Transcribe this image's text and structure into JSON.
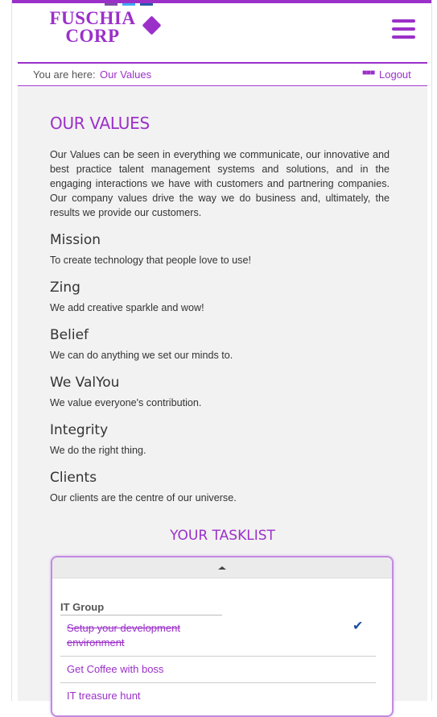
{
  "brand": {
    "line1": "FUSCHIA",
    "line2": "CORP",
    "color": "#9b30c9",
    "social_colors": [
      "#7b4fa3",
      "#3fa9f5",
      "#2a5aa8"
    ]
  },
  "header": {
    "menu_icon": "hamburger-icon"
  },
  "breadcrumb": {
    "prefix": "You are here:",
    "current": "Our Values",
    "menu_icon": "more-dots-icon",
    "logout": "Logout"
  },
  "main": {
    "title": "OUR VALUES",
    "intro": "Our Values can be seen in everything we communicate, our innovative and best practice talent management systems and solutions, and in the engaging interactions we have with customers and partnering companies. Our company values drive the way we do business and, ultimately, the results we provide our customers.",
    "values": [
      {
        "heading": "Mission",
        "text": "To create technology that people love to use!"
      },
      {
        "heading": "Zing",
        "text": "We add creative sparkle and wow!"
      },
      {
        "heading": "Belief",
        "text": "We can do anything we set our minds to."
      },
      {
        "heading": "We ValYou",
        "text": "We value everyone's contribution."
      },
      {
        "heading": "Integrity",
        "text": "We do the right thing."
      },
      {
        "heading": "Clients",
        "text": "Our clients are the centre of our universe."
      }
    ]
  },
  "tasklist": {
    "title": "YOUR TASKLIST",
    "collapse_icon": "caret-up-icon",
    "group": "IT Group",
    "tasks": [
      {
        "label": "Setup your development environment",
        "done": true,
        "icon": "checkmark-icon"
      },
      {
        "label": "Get Coffee with boss",
        "done": false
      },
      {
        "label": "IT treasure hunt",
        "done": false
      }
    ]
  }
}
